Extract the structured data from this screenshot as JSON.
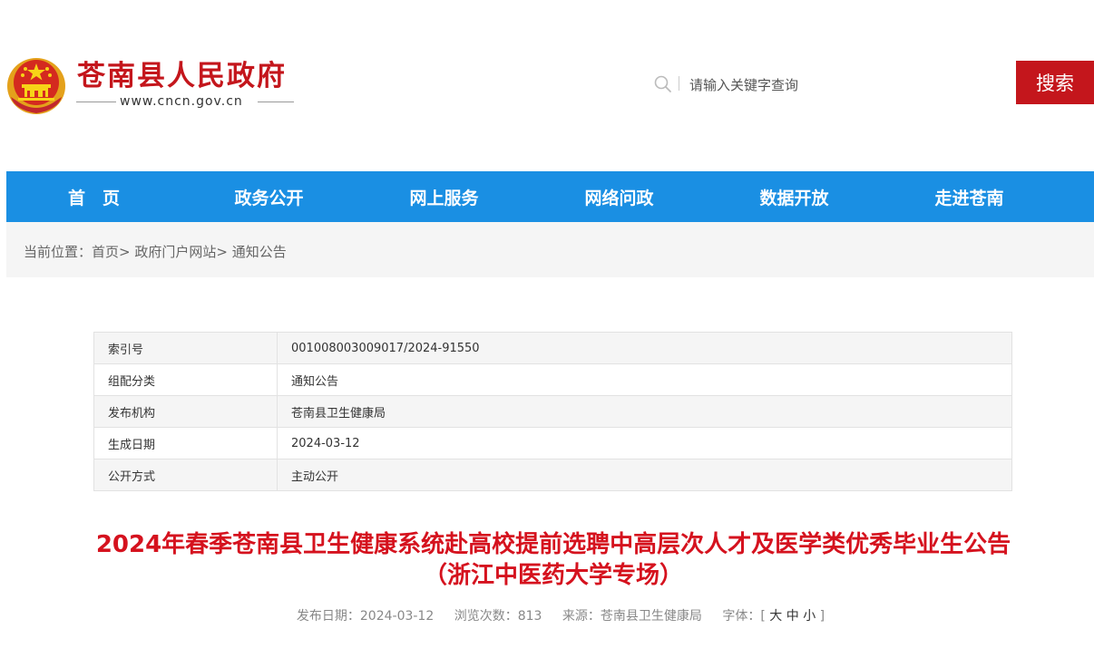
{
  "header": {
    "site_title": "苍南县人民政府",
    "site_url": "www.cncn.gov.cn",
    "search": {
      "placeholder": "请输入关键字查询",
      "button_label": "搜索",
      "icon": "search-icon"
    }
  },
  "nav": {
    "items": [
      "首　页",
      "政务公开",
      "网上服务",
      "网络问政",
      "数据开放",
      "走进苍南"
    ]
  },
  "breadcrumb": {
    "prefix": "当前位置：",
    "items": [
      "首页",
      "政府门户网站",
      "通知公告"
    ],
    "separator": ">"
  },
  "info_table": [
    {
      "key": "索引号",
      "value": "001008003009017/2024-91550"
    },
    {
      "key": "组配分类",
      "value": "通知公告"
    },
    {
      "key": "发布机构",
      "value": "苍南县卫生健康局"
    },
    {
      "key": "生成日期",
      "value": "2024-03-12"
    },
    {
      "key": "公开方式",
      "value": "主动公开"
    }
  ],
  "article": {
    "title_line1": "2024年春季苍南县卫生健康系统赴高校提前选聘中高层次人才及医学类优秀毕业生公告",
    "title_line2": "（浙江中医药大学专场）",
    "publish_date": "发布日期：2024-03-12",
    "views": "浏览次数：813",
    "source": "来源：苍南县卫生健康局",
    "font_size_label": "字体：",
    "font_open": "[",
    "font_large": "大",
    "font_medium": "中",
    "font_small": "小",
    "font_close": "]"
  },
  "colors": {
    "brand_red": "#c4161c",
    "nav_blue": "#1a8fe3",
    "title_red": "#d5121e"
  }
}
